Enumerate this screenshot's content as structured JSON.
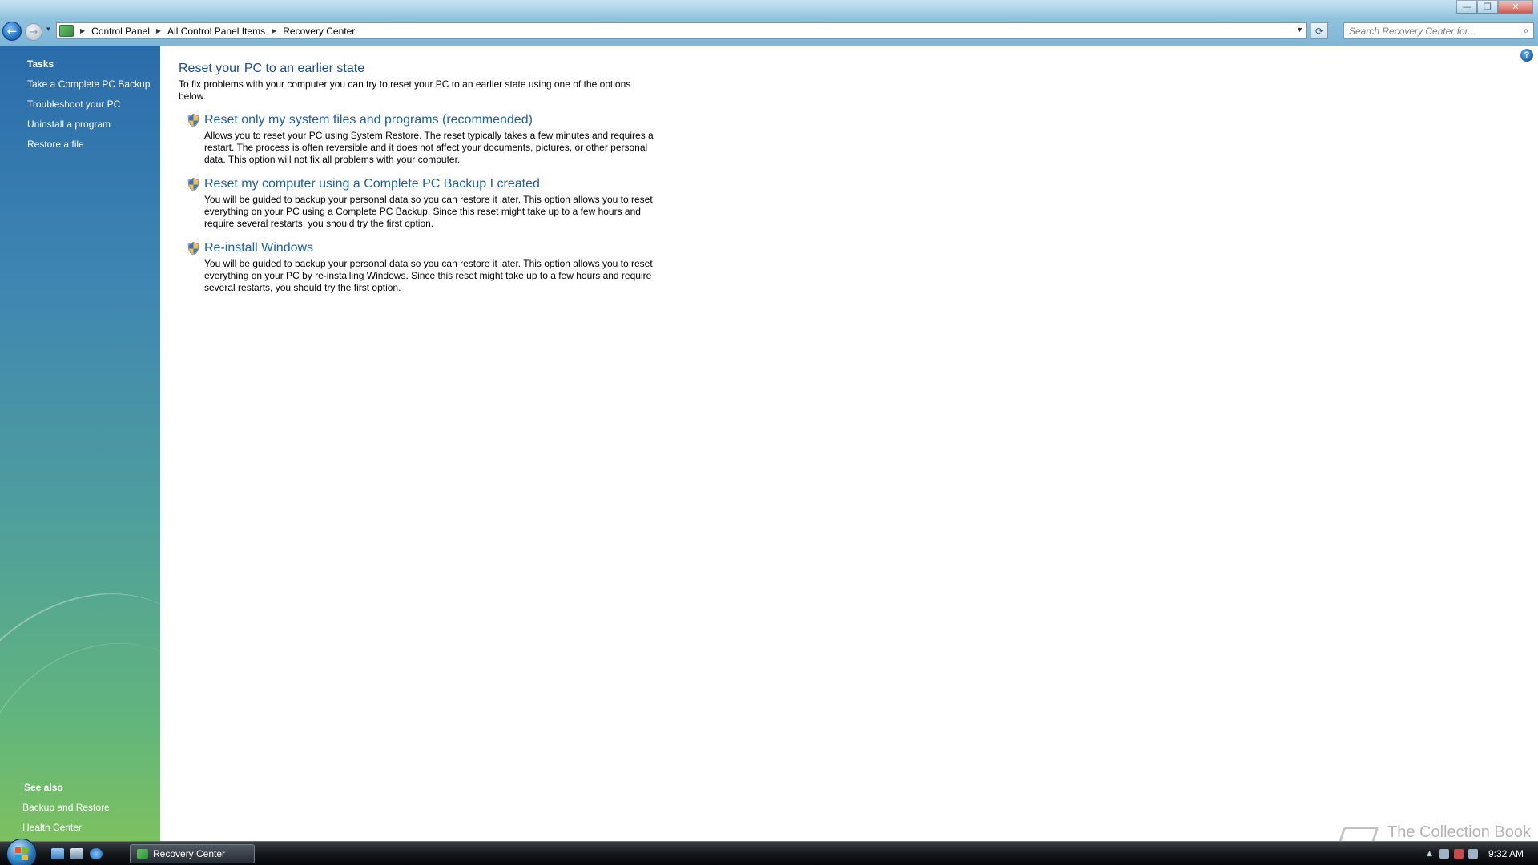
{
  "window": {
    "minimize_label": "—",
    "maximize_label": "❐",
    "close_label": "✕"
  },
  "nav": {
    "back_glyph": "←",
    "forward_glyph": "→",
    "history_glyph": "▾",
    "breadcrumb": [
      "Control Panel",
      "All Control Panel Items",
      "Recovery Center"
    ],
    "refresh_glyph": "⟳",
    "search_placeholder": "Search Recovery Center for...",
    "search_glyph": "⌕"
  },
  "sidebar": {
    "tasks_heading": "Tasks",
    "tasks": [
      "Take a Complete PC Backup",
      "Troubleshoot your PC",
      "Uninstall a program",
      "Restore a file"
    ],
    "see_also_heading": "See also",
    "see_also": [
      "Backup and Restore",
      "Health Center"
    ]
  },
  "main": {
    "help_glyph": "?",
    "title": "Reset your PC to an earlier state",
    "description": "To fix problems with your computer you can try to reset your PC to an earlier state using one of the options below.",
    "options": [
      {
        "title": "Reset only my system files and programs (recommended)",
        "description": "Allows you to reset your PC using System Restore. The reset typically takes a few minutes and requires a restart. The process is often reversible and it does not affect your documents, pictures, or other personal data. This option will not fix all problems with your computer."
      },
      {
        "title": "Reset my computer using a Complete PC Backup I created",
        "description": "You will be guided to backup your personal data so you can restore it later. This option allows you to reset everything on your PC using a Complete PC Backup. Since this reset might take up to a few hours and require several restarts, you should try the first option."
      },
      {
        "title": "Re-install Windows",
        "description": "You will be guided to backup your personal data so you can restore it later. This option allows you to reset everything on your PC by re-installing Windows. Since this reset might take up to a few hours and require several restarts, you should try the first option."
      }
    ]
  },
  "taskbar": {
    "active_window": "Recovery Center",
    "clock": "9:32 AM"
  },
  "watermark": "The Collection Book",
  "colors": {
    "link": "#1e5fa8",
    "title": "#1e4d8c",
    "sidebar_top": "#2a6cab",
    "sidebar_bottom": "#7cc160"
  }
}
